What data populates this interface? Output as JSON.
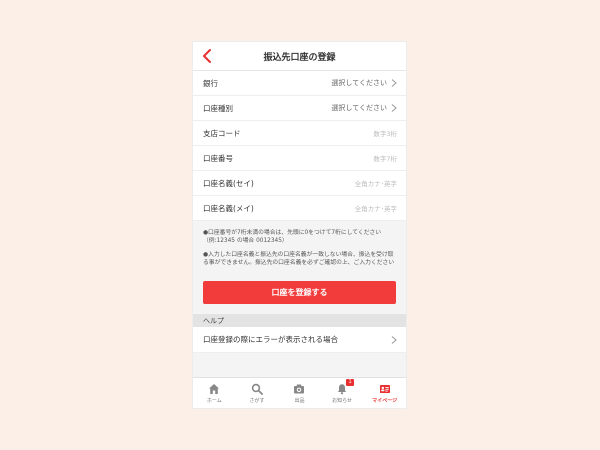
{
  "header": {
    "title": "振込先口座の登録"
  },
  "form": {
    "rows": [
      {
        "label": "銀行",
        "value": "選択してください"
      },
      {
        "label": "口座種別",
        "value": "選択してください"
      },
      {
        "label": "支店コード",
        "placeholder": "数字3桁"
      },
      {
        "label": "口座番号",
        "placeholder": "数字7桁"
      },
      {
        "label": "口座名義(セイ)",
        "placeholder": "全角カナ･英字"
      },
      {
        "label": "口座名義(メイ)",
        "placeholder": "全角カナ･英字"
      }
    ]
  },
  "notes": {
    "note1": "●口座番号が7桁未満の場合は、先頭に0をつけて7桁にしてください（例:12345 の場合 0012345）",
    "note2": "●入力した口座名義と振込先の口座名義が一致しない場合、振込を受け取る事ができません。振込先の口座名義を必ずご確認の上、ご入力ください"
  },
  "submit": {
    "label": "口座を登録する"
  },
  "help": {
    "section_title": "ヘルプ",
    "items": [
      {
        "label": "口座登録の際にエラーが表示される場合"
      }
    ]
  },
  "tabbar": {
    "tabs": [
      {
        "label": "ホーム",
        "icon": "home-icon"
      },
      {
        "label": "さがす",
        "icon": "search-icon"
      },
      {
        "label": "出品",
        "icon": "camera-icon"
      },
      {
        "label": "お知らせ",
        "icon": "bell-icon",
        "badge": "1"
      },
      {
        "label": "マイページ",
        "icon": "mypage-icon",
        "active": true
      }
    ]
  },
  "colors": {
    "accent": "#f23b3b",
    "background": "#fcefe7"
  }
}
